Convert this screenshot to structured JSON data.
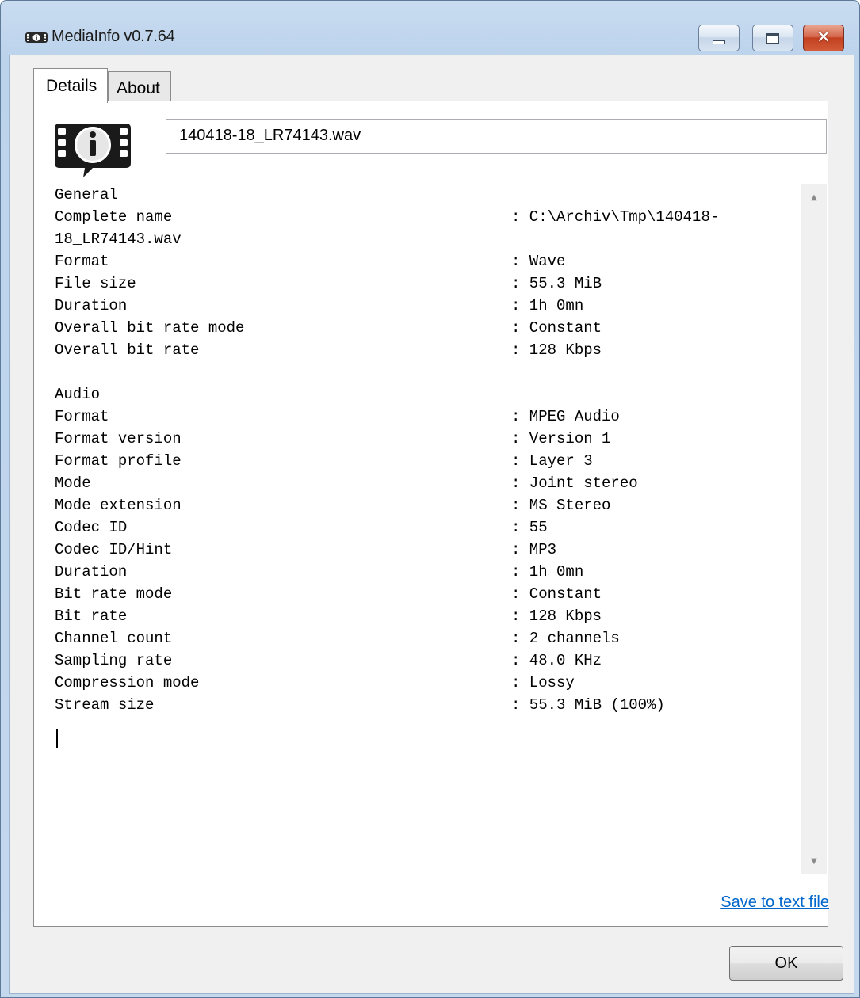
{
  "window": {
    "title": "MediaInfo v0.7.64",
    "icons": {
      "app": "mediainfo-app-icon",
      "minimize": "minimize-icon",
      "maximize": "maximize-icon",
      "close": "close-icon"
    },
    "close_glyph": "✕"
  },
  "tabs": [
    {
      "label": "Details",
      "active": true
    },
    {
      "label": "About",
      "active": false
    }
  ],
  "file_field": {
    "value": "140418-18_LR74143.wav"
  },
  "info": {
    "lines": [
      {
        "label": "General",
        "value": ""
      },
      {
        "label": "Complete name",
        "value": ": C:\\Archiv\\Tmp\\140418-"
      },
      {
        "label": "18_LR74143.wav",
        "value": ""
      },
      {
        "label": "Format",
        "value": ": Wave"
      },
      {
        "label": "File size",
        "value": ": 55.3 MiB"
      },
      {
        "label": "Duration",
        "value": ": 1h 0mn"
      },
      {
        "label": "Overall bit rate mode",
        "value": ": Constant"
      },
      {
        "label": "Overall bit rate",
        "value": ": 128 Kbps"
      },
      {
        "label": "",
        "value": ""
      },
      {
        "label": "Audio",
        "value": ""
      },
      {
        "label": "Format",
        "value": ": MPEG Audio"
      },
      {
        "label": "Format version",
        "value": ": Version 1"
      },
      {
        "label": "Format profile",
        "value": ": Layer 3"
      },
      {
        "label": "Mode",
        "value": ": Joint stereo"
      },
      {
        "label": "Mode extension",
        "value": ": MS Stereo"
      },
      {
        "label": "Codec ID",
        "value": ": 55"
      },
      {
        "label": "Codec ID/Hint",
        "value": ": MP3"
      },
      {
        "label": "Duration",
        "value": ": 1h 0mn"
      },
      {
        "label": "Bit rate mode",
        "value": ": Constant"
      },
      {
        "label": "Bit rate",
        "value": ": 128 Kbps"
      },
      {
        "label": "Channel count",
        "value": ": 2 channels"
      },
      {
        "label": "Sampling rate",
        "value": ": 48.0 KHz"
      },
      {
        "label": "Compression mode",
        "value": ": Lossy"
      },
      {
        "label": "Stream size",
        "value": ": 55.3 MiB (100%)"
      }
    ]
  },
  "save_link": {
    "label": "Save to text file"
  },
  "ok_button": {
    "label": "OK"
  },
  "colors": {
    "link": "#0066cc",
    "title_bar": "#c9dcf0",
    "close_button": "#c2401f"
  }
}
